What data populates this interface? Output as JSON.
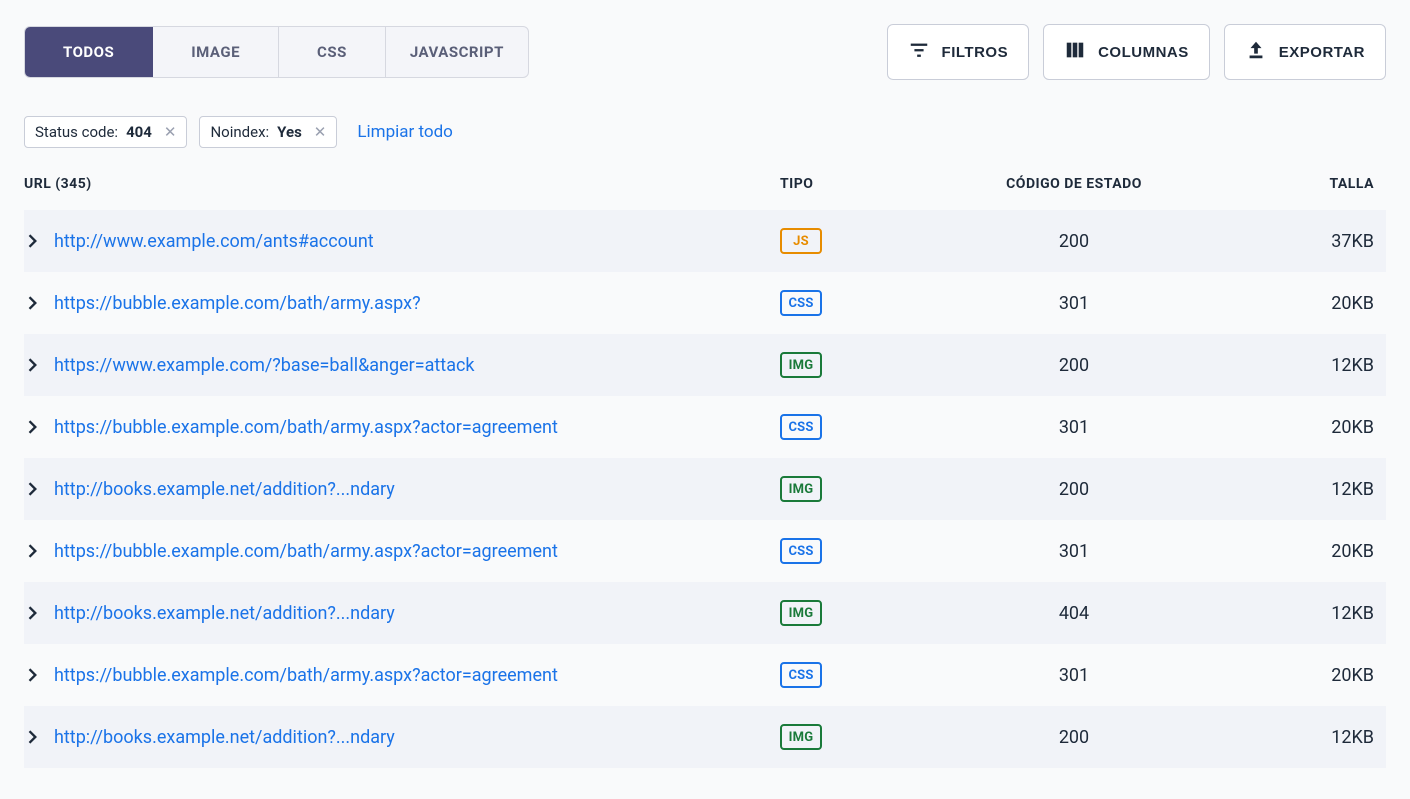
{
  "tabs": [
    {
      "label": "TODOS",
      "active": true
    },
    {
      "label": "IMAGE",
      "active": false
    },
    {
      "label": "CSS",
      "active": false
    },
    {
      "label": "JAVASCRIPT",
      "active": false
    }
  ],
  "actions": {
    "filters": "FILTROS",
    "columns": "COLUMNAS",
    "export": "EXPORTAR"
  },
  "filters": [
    {
      "label": "Status code:",
      "value": "404"
    },
    {
      "label": "Noindex:",
      "value": "Yes"
    }
  ],
  "clear_all": "Limpiar todo",
  "columns": {
    "url": "URL (345)",
    "tipo": "TIPO",
    "codigo": "CÓDIGO DE ESTADO",
    "talla": "TALLA"
  },
  "rows": [
    {
      "url": "http://www.example.com/ants#account",
      "type": "JS",
      "type_class": "js",
      "code": "200",
      "size": "37KB"
    },
    {
      "url": "https://bubble.example.com/bath/army.aspx?",
      "type": "CSS",
      "type_class": "css",
      "code": "301",
      "size": "20KB"
    },
    {
      "url": "https://www.example.com/?base=ball&anger=attack",
      "type": "IMG",
      "type_class": "img",
      "code": "200",
      "size": "12KB"
    },
    {
      "url": "https://bubble.example.com/bath/army.aspx?actor=agreement",
      "type": "CSS",
      "type_class": "css",
      "code": "301",
      "size": "20KB"
    },
    {
      "url": "http://books.example.net/addition?...ndary",
      "type": "IMG",
      "type_class": "img",
      "code": "200",
      "size": "12KB"
    },
    {
      "url": "https://bubble.example.com/bath/army.aspx?actor=agreement",
      "type": "CSS",
      "type_class": "css",
      "code": "301",
      "size": "20KB"
    },
    {
      "url": "http://books.example.net/addition?...ndary",
      "type": "IMG",
      "type_class": "img",
      "code": "404",
      "size": "12KB"
    },
    {
      "url": "https://bubble.example.com/bath/army.aspx?actor=agreement",
      "type": "CSS",
      "type_class": "css",
      "code": "301",
      "size": "20KB"
    },
    {
      "url": "http://books.example.net/addition?...ndary",
      "type": "IMG",
      "type_class": "img",
      "code": "200",
      "size": "12KB"
    }
  ]
}
